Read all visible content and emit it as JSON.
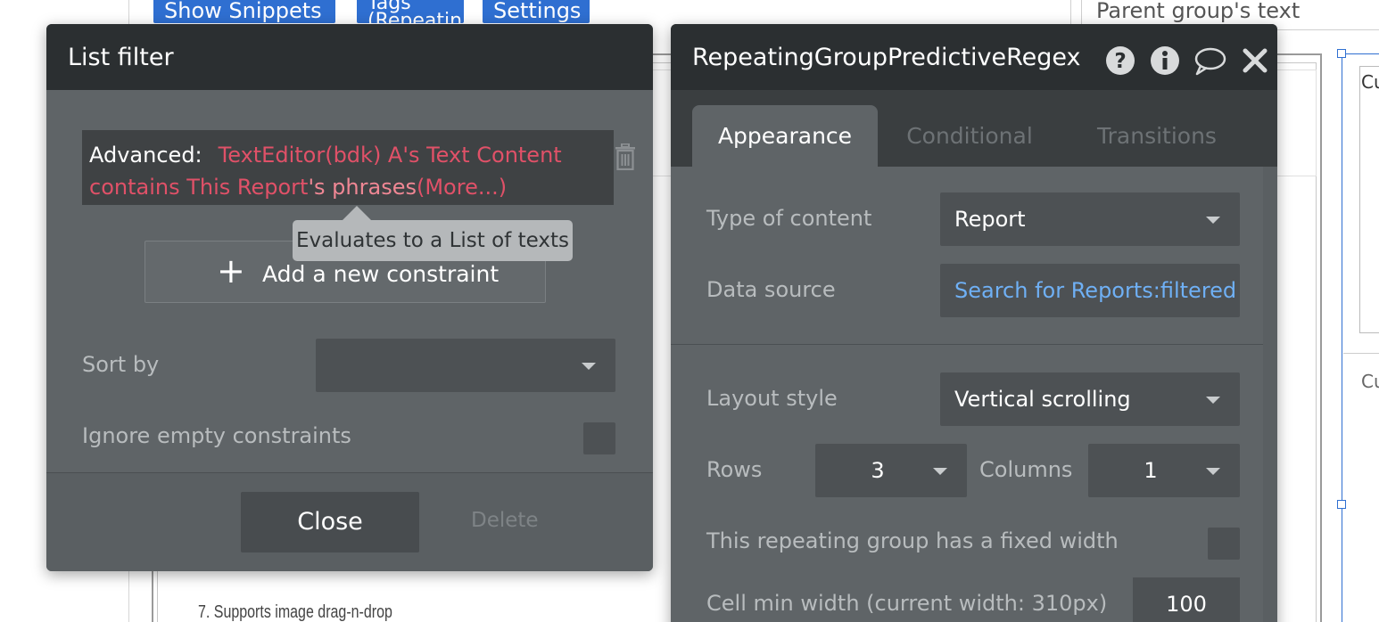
{
  "background": {
    "top_buttons": {
      "show_snippets": "Show Snippets",
      "tags": "Tags (Repeatin",
      "settings": "Settings"
    },
    "parent_group_text": "Parent group's text",
    "canvas_text_1": "7. Supports image drag-n-drop",
    "right_clip_1": "Cu",
    "right_clip_2": "Cu"
  },
  "list_filter": {
    "title": "List filter",
    "expression": {
      "keyword": "Advanced:",
      "part1": "TextEditor(bdk) A's Text Content contains This Report",
      "part2": "'s phrases",
      "part3": "(More...)"
    },
    "tooltip": "Evaluates to a List of texts",
    "add_constraint": "Add a new constraint",
    "sort_by_label": "Sort by",
    "sort_by_value": "",
    "ignore_empty_label": "Ignore empty constraints",
    "close_label": "Close",
    "delete_label": "Delete"
  },
  "repeating_group": {
    "title": "RepeatingGroupPredictiveRegex",
    "tabs": [
      "Appearance",
      "Conditional",
      "Transitions"
    ],
    "type_of_content_label": "Type of content",
    "type_of_content_value": "Report",
    "data_source_label": "Data source",
    "data_source_value": "Search for Reports:filtered",
    "layout_style_label": "Layout style",
    "layout_style_value": "Vertical scrolling",
    "rows_label": "Rows",
    "rows_value": "3",
    "columns_label": "Columns",
    "columns_value": "1",
    "fixed_width_label": "This repeating group has a fixed width",
    "cell_min_width_label": "Cell min width (current width: 310px)",
    "cell_min_width_value": "100"
  },
  "colors": {
    "panel_bg": "#5f6467",
    "header_bg": "#2b2f31",
    "expression_red": "#e05168",
    "link_blue": "#6fb0f5",
    "button_blue": "#2f6fd1"
  }
}
